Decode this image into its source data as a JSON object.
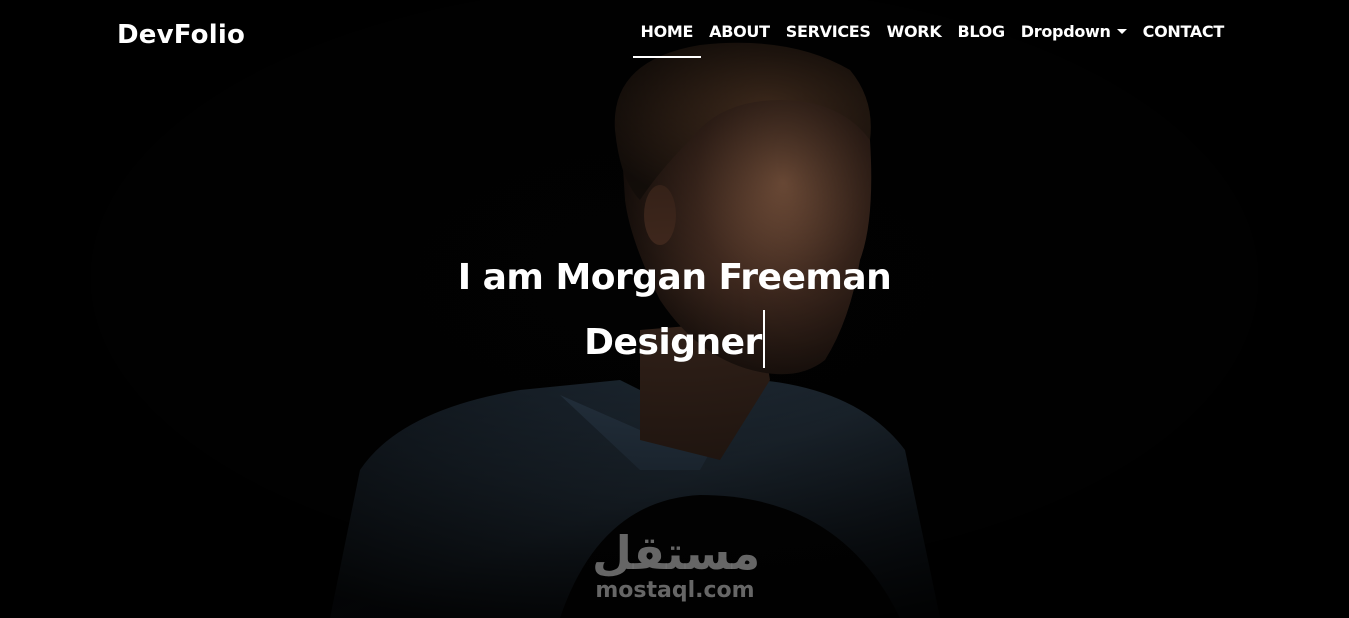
{
  "brand": {
    "name": "DevFolio"
  },
  "nav": {
    "items": [
      {
        "label": "HOME",
        "active": true
      },
      {
        "label": "ABOUT",
        "active": false
      },
      {
        "label": "SERVICES",
        "active": false
      },
      {
        "label": "WORK",
        "active": false
      },
      {
        "label": "BLOG",
        "active": false
      },
      {
        "label": "Dropdown",
        "active": false,
        "has_caret": true
      },
      {
        "label": "CONTACT",
        "active": false
      }
    ]
  },
  "intro": {
    "title": "I am Morgan Freeman",
    "subtitle": "Designer"
  },
  "watermark": {
    "arabic": "مستقل",
    "latin": "mostaql.com"
  },
  "colors": {
    "background": "#000000",
    "text": "#ffffff",
    "watermark": "#787878"
  },
  "icons": {
    "dropdown_caret": "caret-down-icon",
    "text_cursor": "typed-cursor"
  }
}
